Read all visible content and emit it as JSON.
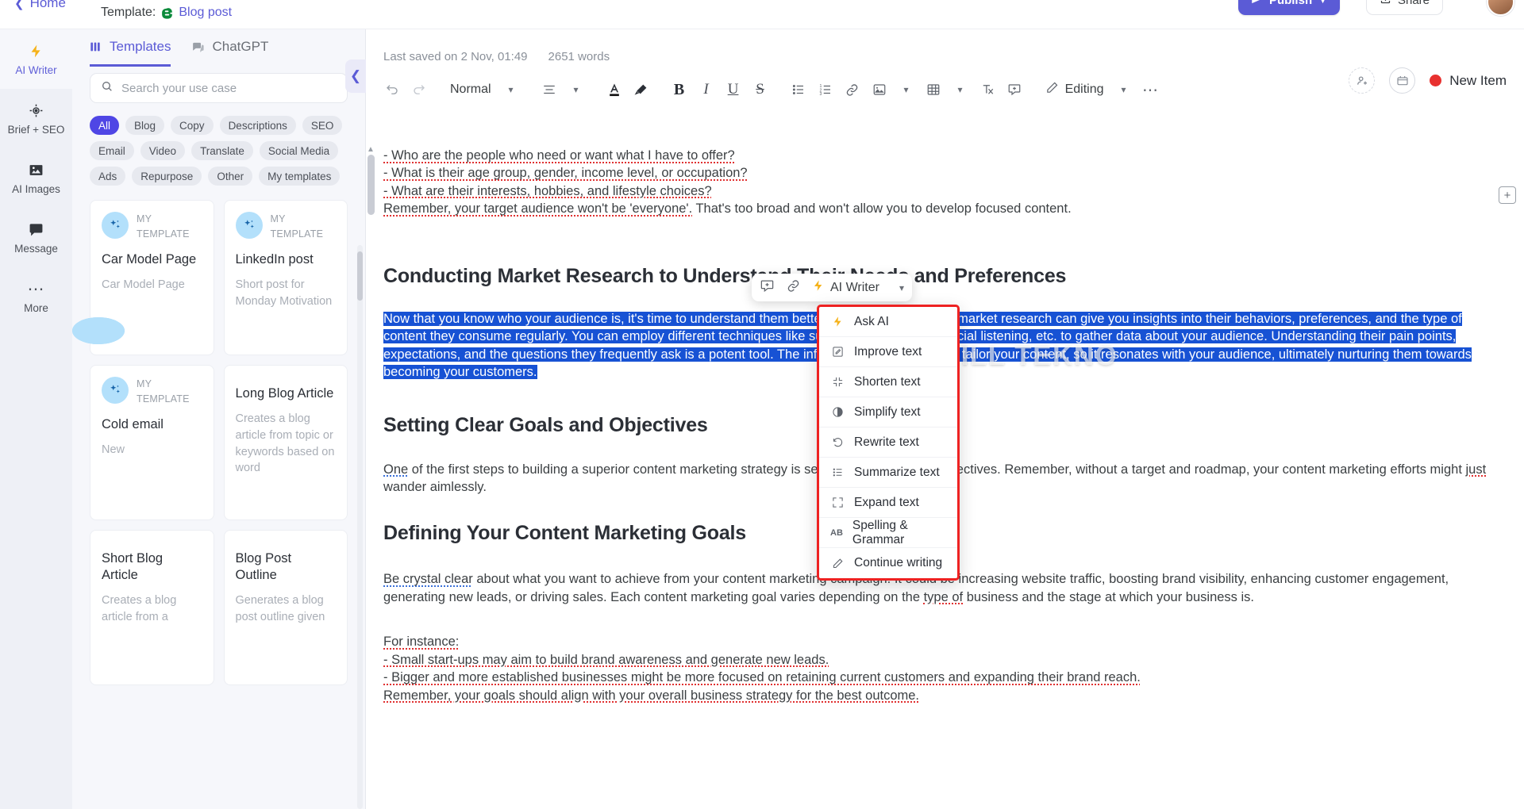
{
  "topbar": {
    "home_label": "Home",
    "template_prefix": "Template:",
    "template_name": "Blog post",
    "publish_label": "Publish",
    "share_label": "Share"
  },
  "rail": {
    "items": [
      {
        "label": "AI Writer",
        "icon": "bolt-icon",
        "active": true
      },
      {
        "label": "Brief + SEO",
        "icon": "target-icon",
        "active": false
      },
      {
        "label": "AI Images",
        "icon": "image-icon",
        "active": false
      },
      {
        "label": "Message",
        "icon": "message-icon",
        "active": false
      },
      {
        "label": "More",
        "icon": "ellipsis-icon",
        "active": false
      }
    ]
  },
  "panel": {
    "tabs": [
      {
        "label": "Templates",
        "icon": "grid-icon",
        "active": true
      },
      {
        "label": "ChatGPT",
        "icon": "chat-icon",
        "active": false
      }
    ],
    "search_placeholder": "Search your use case",
    "search_value": "",
    "chips": [
      {
        "label": "All",
        "active": true
      },
      {
        "label": "Blog",
        "active": false
      },
      {
        "label": "Copy",
        "active": false
      },
      {
        "label": "Descriptions",
        "active": false
      },
      {
        "label": "SEO",
        "active": false
      },
      {
        "label": "Email",
        "active": false
      },
      {
        "label": "Video",
        "active": false
      },
      {
        "label": "Translate",
        "active": false
      },
      {
        "label": "Social Media",
        "active": false
      },
      {
        "label": "Ads",
        "active": false
      },
      {
        "label": "Repurpose",
        "active": false
      },
      {
        "label": "Other",
        "active": false
      },
      {
        "label": "My templates",
        "active": false
      }
    ],
    "cards": [
      {
        "kicker": "MY TEMPLATE",
        "title": "Car Model Page",
        "desc": "Car Model Page",
        "badge": "sparkle-icon"
      },
      {
        "kicker": "MY TEMPLATE",
        "title": "LinkedIn post",
        "desc": "Short post for Monday Motivation",
        "badge": "sparkle-icon"
      },
      {
        "kicker": "MY TEMPLATE",
        "title": "Cold email",
        "desc": "New",
        "badge": "sparkle-icon"
      },
      {
        "kicker": "",
        "title": "Long Blog Article",
        "desc": "Creates a blog article from topic or keywords based on word",
        "badge": "document-icon"
      },
      {
        "kicker": "",
        "title": "Short Blog Article",
        "desc": "Creates a blog article from a",
        "badge": "document-icon"
      },
      {
        "kicker": "",
        "title": "Blog Post Outline",
        "desc": "Generates a blog post outline given",
        "badge": "document-icon"
      }
    ]
  },
  "editor": {
    "last_saved": "Last saved on 2 Nov, 01:49",
    "word_count": "2651 words",
    "new_item_label": "New Item",
    "toolbar": {
      "style_label": "Normal",
      "editing_label": "Editing"
    },
    "float_toolbar": {
      "ai_label": "AI Writer"
    },
    "ai_menu": [
      {
        "label": "Ask AI",
        "icon": "bolt-icon"
      },
      {
        "label": "Improve text",
        "icon": "pencil-square-icon"
      },
      {
        "label": "Shorten text",
        "icon": "shrink-icon"
      },
      {
        "label": "Simplify text",
        "icon": "contrast-icon"
      },
      {
        "label": "Rewrite text",
        "icon": "undo-icon"
      },
      {
        "label": "Summarize text",
        "icon": "list-icon"
      },
      {
        "label": "Expand text",
        "icon": "expand-icon"
      },
      {
        "label": "Spelling & Grammar",
        "icon": "ab-icon"
      },
      {
        "label": "Continue writing",
        "icon": "pen-icon"
      }
    ],
    "watermark": "SPILL TEKNO",
    "content": {
      "bullet1": "- Who are the people who need or want what I have to offer?",
      "bullet2": "- What is their age group, gender, income level, or occupation?",
      "bullet3": "- What are their interests, hobbies, and lifestyle choices?",
      "remember_a": "Remember, your target audience won't be 'everyone'.",
      "remember_b": " That's too broad and won't allow you to develop focused content.",
      "h2_market": "Conducting Market Research to Understand Their Needs and Preferences",
      "selected_paragraph": "Now that you know who your audience is, it's time to understand them better. Conducting thorough market research can give you insights into their behaviors, preferences, and the type of content they consume regularly. You can employ different techniques like surveys, focus groups, social listening, etc. to gather data about your audience. Understanding their pain points, expectations, and the questions they frequently ask is a potent tool. The information collected helps tailor your content, so it resonates with your audience, ultimately nurturing them towards becoming your customers.",
      "h2_setting": "Setting Clear Goals and Objectives",
      "goals_para": "One of the first steps to building a superior content marketing strategy is setting clear goals and objectives. Remember, without a target and roadmap, your content marketing efforts might just wander aimlessly.",
      "h2_defining": "Defining Your Content Marketing Goals",
      "defining_para_a": "Be crystal clear",
      "defining_para_b": " about what you want to achieve from your content marketing campaign. It could be increasing website traffic, boosting brand visibility, enhancing customer engagement, generating new leads, or driving sales. Each content marketing goal varies depending on the ",
      "defining_para_c": "type of",
      "defining_para_d": " business and the stage at which your business is.",
      "for_instance": "For instance:",
      "fi1": "- Small start-ups may aim to build brand awareness and generate new leads.",
      "fi2": "- Bigger and more established businesses might be more focused on retaining current customers and expanding their brand reach.",
      "fi3": "Remember, your goals should align with your overall business strategy for the best outcome."
    }
  },
  "colors": {
    "accent": "#5b5bd6",
    "chip_active": "#4f46e5",
    "selection": "#1752d4",
    "menu_border": "#ee2222",
    "red_dot": "#e8312f"
  }
}
